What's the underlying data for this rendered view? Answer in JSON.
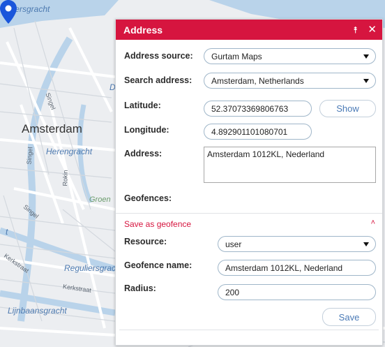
{
  "map": {
    "labels": {
      "top_left": "uwersgracht",
      "city": "Amsterdam",
      "heregracht": "Herengracht",
      "singel1": "Singel",
      "singel2": "Singel",
      "singel3": "Singel",
      "rokin": "Rokin",
      "groenburgwal": "Groen",
      "reguliersgracht": "Reguliersgrac",
      "kerkstraat1": "Kerkstraat",
      "kerkstraat2": "Kerkstraat",
      "lijnbaansgracht": "Lijnbaansgracht",
      "edge_letter": "D",
      "edge_t": "t"
    },
    "pin_color": "#1a56db"
  },
  "dialog": {
    "title": "Address",
    "header_color": "#d6153f",
    "collapse_icon": "double-chevron-up-icon",
    "close_icon": "close-icon",
    "address_source": {
      "label": "Address source:",
      "value": "Gurtam Maps"
    },
    "search_address": {
      "label": "Search address:",
      "value": "Amsterdam, Netherlands"
    },
    "latitude": {
      "label": "Latitude:",
      "value": "52.37073369806763"
    },
    "longitude": {
      "label": "Longitude:",
      "value": "4.892901101080701"
    },
    "show_button": "Show",
    "address": {
      "label": "Address:",
      "value": "Amsterdam 1012KL, Nederland"
    },
    "geofences": {
      "label": "Geofences:"
    },
    "save_as_geofence": {
      "title": "Save as geofence",
      "chevron_icon": "chevron-up-icon",
      "resource": {
        "label": "Resource:",
        "value": "user"
      },
      "geofence_name": {
        "label": "Geofence name:",
        "value": "Amsterdam 1012KL, Nederland"
      },
      "radius": {
        "label": "Radius:",
        "value": "200"
      },
      "save_button": "Save"
    }
  }
}
